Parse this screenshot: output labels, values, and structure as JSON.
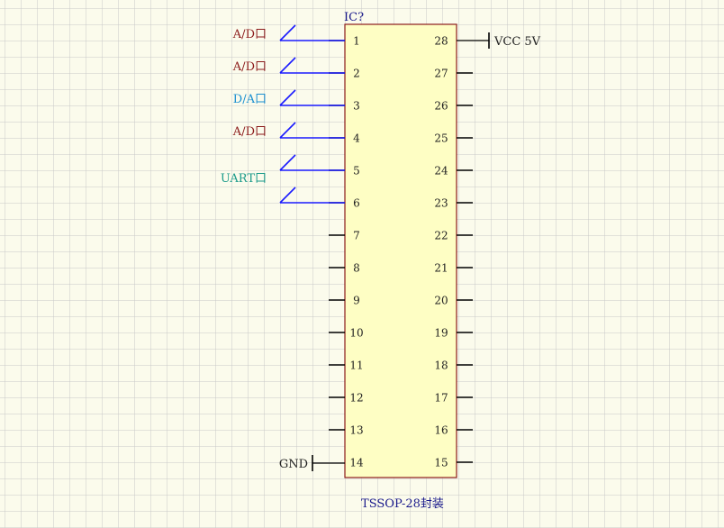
{
  "component": {
    "designator": "IC?",
    "package_label": "TSSOP-28封装",
    "body_color": "#fefec4",
    "border_color": "#8b1a1a",
    "pins_left": [
      "1",
      "2",
      "3",
      "4",
      "5",
      "6",
      "7",
      "8",
      "9",
      "10",
      "11",
      "12",
      "13",
      "14"
    ],
    "pins_right": [
      "28",
      "27",
      "26",
      "25",
      "24",
      "23",
      "22",
      "21",
      "20",
      "19",
      "18",
      "17",
      "16",
      "15"
    ]
  },
  "net_labels": [
    {
      "pin": "1",
      "text": "A/D口",
      "color": "#8b1a1a"
    },
    {
      "pin": "2",
      "text": "A/D口",
      "color": "#8b1a1a"
    },
    {
      "pin": "3",
      "text": "D/A口",
      "color": "#1a8fd0"
    },
    {
      "pin": "4",
      "text": "A/D口",
      "color": "#8b1a1a"
    },
    {
      "pin": "5",
      "text": "UART口",
      "color": "#1a9a8a"
    }
  ],
  "power": {
    "vcc": {
      "text": "VCC 5V",
      "pin": "28"
    },
    "gnd": {
      "text": "GND",
      "pin": "14"
    }
  },
  "colors": {
    "wire": "#1a1aff",
    "pin": "#000000",
    "grid": "#c8c8c8",
    "designator": "#1a1a8b",
    "package": "#1a1a8b"
  }
}
